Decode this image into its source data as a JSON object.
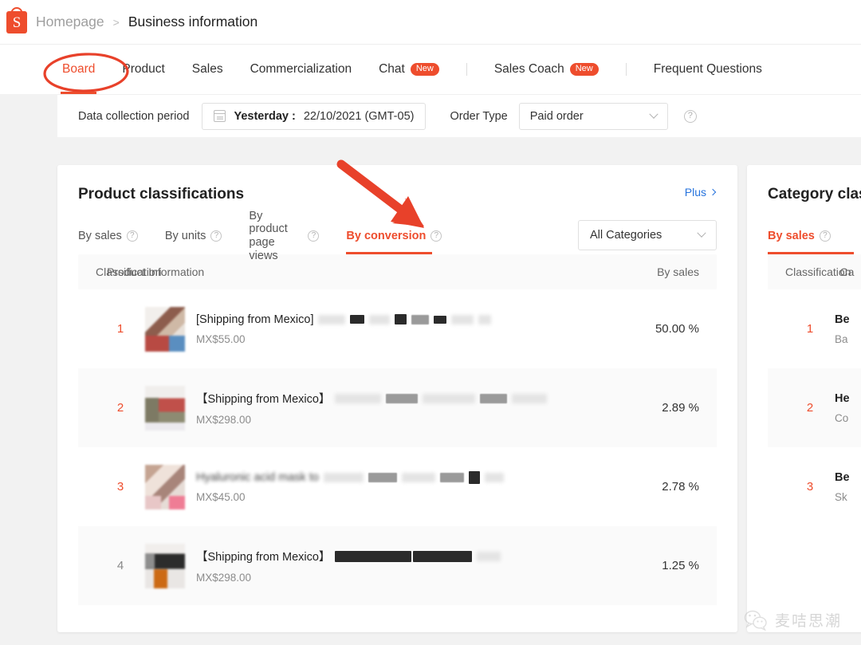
{
  "breadcrumb": {
    "logo_icon": "shopee-logo-icon",
    "home": "Homepage",
    "separator": ">",
    "current": "Business information"
  },
  "nav_tabs": [
    {
      "label": "Board",
      "active": true,
      "badge": null,
      "divider_before": false
    },
    {
      "label": "Product",
      "active": false,
      "badge": null,
      "divider_before": false
    },
    {
      "label": "Sales",
      "active": false,
      "badge": null,
      "divider_before": false
    },
    {
      "label": "Commercialization",
      "active": false,
      "badge": null,
      "divider_before": false
    },
    {
      "label": "Chat",
      "active": false,
      "badge": "New",
      "divider_before": false
    },
    {
      "label": "Sales Coach",
      "active": false,
      "badge": "New",
      "divider_before": true
    },
    {
      "label": "Frequent Questions",
      "active": false,
      "badge": null,
      "divider_before": true
    }
  ],
  "filters": {
    "period_label": "Data collection period",
    "calendar_icon": "calendar-icon",
    "date_strong": "Yesterday :",
    "date_value": "22/10/2021 (GMT-05)",
    "order_type_label": "Order Type",
    "order_type_value": "Paid order",
    "order_type_chevron": "chevron-down-icon",
    "help_icon": "question-mark-icon"
  },
  "products_panel": {
    "title": "Product classifications",
    "plus_link": "Plus",
    "plus_chevron": "chevron-right-icon",
    "tabs": [
      {
        "label": "By sales",
        "active": false,
        "help": "?"
      },
      {
        "label": "By units",
        "active": false,
        "help": "?"
      },
      {
        "label": "By product page views",
        "active": false,
        "help": "?"
      },
      {
        "label": "By conversion",
        "active": true,
        "help": "?"
      }
    ],
    "category_filter": {
      "value": "All Categories",
      "chevron": "chevron-down-icon"
    },
    "columns": {
      "rank": "Classification",
      "product": "Product Information",
      "value": "By sales"
    },
    "rows": [
      {
        "rank": "1",
        "title": "[Shipping from Mexico]",
        "price": "MX$55.00",
        "value": "50.00 %",
        "alt": false,
        "rank_dim": false
      },
      {
        "rank": "2",
        "title": "【Shipping from Mexico】",
        "price": "MX$298.00",
        "value": "2.89 %",
        "alt": true,
        "rank_dim": false
      },
      {
        "rank": "3",
        "title": "Hyaluronic acid mask to",
        "price": "MX$45.00",
        "value": "2.78 %",
        "alt": false,
        "rank_dim": false
      },
      {
        "rank": "4",
        "title": "【Shipping from Mexico】",
        "price": "MX$298.00",
        "value": "1.25 %",
        "alt": true,
        "rank_dim": true
      }
    ]
  },
  "category_panel": {
    "title": "Category clas",
    "tabs": [
      {
        "label": "By sales",
        "active": true,
        "help": "?"
      }
    ],
    "columns": {
      "rank": "Classification",
      "category": "Ca"
    },
    "rows": [
      {
        "rank": "1",
        "name": "Be",
        "sub": "Ba",
        "alt": false
      },
      {
        "rank": "2",
        "name": "He",
        "sub": "Co",
        "alt": true
      },
      {
        "rank": "3",
        "name": "Be",
        "sub": "Sk",
        "alt": false
      }
    ]
  },
  "annotations": {
    "ellipse_target": "Board",
    "arrow_target": "By conversion",
    "color": "#e8412a"
  },
  "watermark": {
    "icon": "wechat-icon",
    "text": "麦咭思潮"
  },
  "colors": {
    "brand_orange": "#ee4d2d",
    "link_blue": "#2673dd",
    "annotation_red": "#e8412a"
  }
}
